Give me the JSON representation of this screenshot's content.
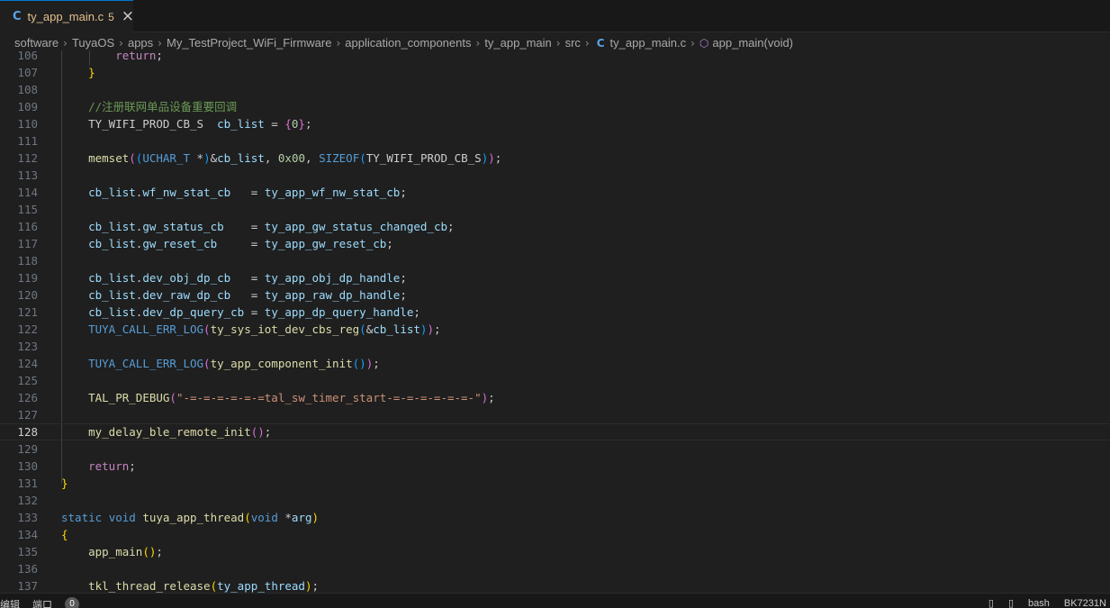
{
  "tab": {
    "title": "ty_app_main.c",
    "modified": "5",
    "icon": "c-file-icon"
  },
  "breadcrumb": {
    "items": [
      "software",
      "TuyaOS",
      "apps",
      "My_TestProject_WiFi_Firmware",
      "application_components",
      "ty_app_main",
      "src"
    ],
    "file": "ty_app_main.c",
    "symbol": "app_main(void)"
  },
  "editor": {
    "active_line": "128",
    "lines": [
      {
        "n": "106",
        "t": "        return;"
      },
      {
        "n": "107",
        "t": "    }"
      },
      {
        "n": "108",
        "t": ""
      },
      {
        "n": "109",
        "t": "    //注册联网单品设备重要回调"
      },
      {
        "n": "110",
        "t": "    TY_WIFI_PROD_CB_S  cb_list = {0};"
      },
      {
        "n": "111",
        "t": ""
      },
      {
        "n": "112",
        "t": "    memset((UCHAR_T *)&cb_list, 0x00, SIZEOF(TY_WIFI_PROD_CB_S));"
      },
      {
        "n": "113",
        "t": ""
      },
      {
        "n": "114",
        "t": "    cb_list.wf_nw_stat_cb   = ty_app_wf_nw_stat_cb;"
      },
      {
        "n": "115",
        "t": ""
      },
      {
        "n": "116",
        "t": "    cb_list.gw_status_cb    = ty_app_gw_status_changed_cb;"
      },
      {
        "n": "117",
        "t": "    cb_list.gw_reset_cb     = ty_app_gw_reset_cb;"
      },
      {
        "n": "118",
        "t": ""
      },
      {
        "n": "119",
        "t": "    cb_list.dev_obj_dp_cb   = ty_app_obj_dp_handle;"
      },
      {
        "n": "120",
        "t": "    cb_list.dev_raw_dp_cb   = ty_app_raw_dp_handle;"
      },
      {
        "n": "121",
        "t": "    cb_list.dev_dp_query_cb = ty_app_dp_query_handle;"
      },
      {
        "n": "122",
        "t": "    TUYA_CALL_ERR_LOG(ty_sys_iot_dev_cbs_reg(&cb_list));"
      },
      {
        "n": "123",
        "t": ""
      },
      {
        "n": "124",
        "t": "    TUYA_CALL_ERR_LOG(ty_app_component_init());"
      },
      {
        "n": "125",
        "t": ""
      },
      {
        "n": "126",
        "t": "    TAL_PR_DEBUG(\"-=-=-=-=-=-=tal_sw_timer_start-=-=-=-=-=-=-\");"
      },
      {
        "n": "127",
        "t": ""
      },
      {
        "n": "128",
        "t": "    my_delay_ble_remote_init();"
      },
      {
        "n": "129",
        "t": ""
      },
      {
        "n": "130",
        "t": "    return;"
      },
      {
        "n": "131",
        "t": "}"
      },
      {
        "n": "132",
        "t": ""
      },
      {
        "n": "133",
        "t": "static void tuya_app_thread(void *arg)"
      },
      {
        "n": "134",
        "t": "{"
      },
      {
        "n": "135",
        "t": "    app_main();"
      },
      {
        "n": "136",
        "t": ""
      },
      {
        "n": "137",
        "t": "    tkl_thread_release(ty_app_thread);"
      }
    ]
  },
  "statusbar": {
    "left_items": [
      "编辑",
      "端口"
    ],
    "badge": "0",
    "right_items": [
      "bash",
      "BK7231N"
    ]
  }
}
